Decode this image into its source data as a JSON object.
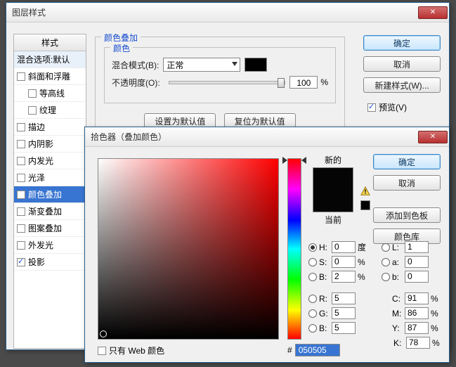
{
  "main": {
    "title": "图层样式",
    "styles_header": "样式",
    "blend_row": "混合选项:默认",
    "items": [
      {
        "label": "斜面和浮雕",
        "checked": false,
        "indent": false
      },
      {
        "label": "等高线",
        "checked": false,
        "indent": true
      },
      {
        "label": "纹理",
        "checked": false,
        "indent": true
      },
      {
        "label": "描边",
        "checked": false,
        "indent": false
      },
      {
        "label": "内阴影",
        "checked": false,
        "indent": false
      },
      {
        "label": "内发光",
        "checked": false,
        "indent": false
      },
      {
        "label": "光泽",
        "checked": false,
        "indent": false
      },
      {
        "label": "颜色叠加",
        "checked": true,
        "indent": false,
        "selected": true
      },
      {
        "label": "渐变叠加",
        "checked": false,
        "indent": false
      },
      {
        "label": "图案叠加",
        "checked": false,
        "indent": false
      },
      {
        "label": "外发光",
        "checked": false,
        "indent": false
      },
      {
        "label": "投影",
        "checked": true,
        "indent": false
      }
    ],
    "overlay": {
      "legend": "颜色叠加",
      "color_legend": "颜色",
      "blend_label": "混合模式(B):",
      "blend_value": "正常",
      "opacity_label": "不透明度(O):",
      "opacity_value": "100",
      "opacity_unit": "%",
      "btn_default": "设置为默认值",
      "btn_reset": "复位为默认值"
    },
    "buttons": {
      "ok": "确定",
      "cancel": "取消",
      "newstyle": "新建样式(W)...",
      "preview": "预览(V)"
    }
  },
  "picker": {
    "title": "拾色器（叠加颜色）",
    "new_label": "新的",
    "current_label": "当前",
    "ok": "确定",
    "cancel": "取消",
    "add_swatch": "添加到色板",
    "libraries": "颜色库",
    "web_only": "只有 Web 颜色",
    "hex_prefix": "#",
    "hex_value": "050505",
    "fields": {
      "H": {
        "label": "H:",
        "val": "0",
        "unit": "度"
      },
      "S": {
        "label": "S:",
        "val": "0",
        "unit": "%"
      },
      "Bv": {
        "label": "B:",
        "val": "2",
        "unit": "%"
      },
      "R": {
        "label": "R:",
        "val": "5",
        "unit": ""
      },
      "G": {
        "label": "G:",
        "val": "5",
        "unit": ""
      },
      "Bc": {
        "label": "B:",
        "val": "5",
        "unit": ""
      },
      "L": {
        "label": "L:",
        "val": "1",
        "unit": ""
      },
      "a": {
        "label": "a:",
        "val": "0",
        "unit": ""
      },
      "b": {
        "label": "b:",
        "val": "0",
        "unit": ""
      },
      "C": {
        "label": "C:",
        "val": "91",
        "unit": "%"
      },
      "M": {
        "label": "M:",
        "val": "86",
        "unit": "%"
      },
      "Y": {
        "label": "Y:",
        "val": "87",
        "unit": "%"
      },
      "K": {
        "label": "K:",
        "val": "78",
        "unit": "%"
      }
    }
  }
}
